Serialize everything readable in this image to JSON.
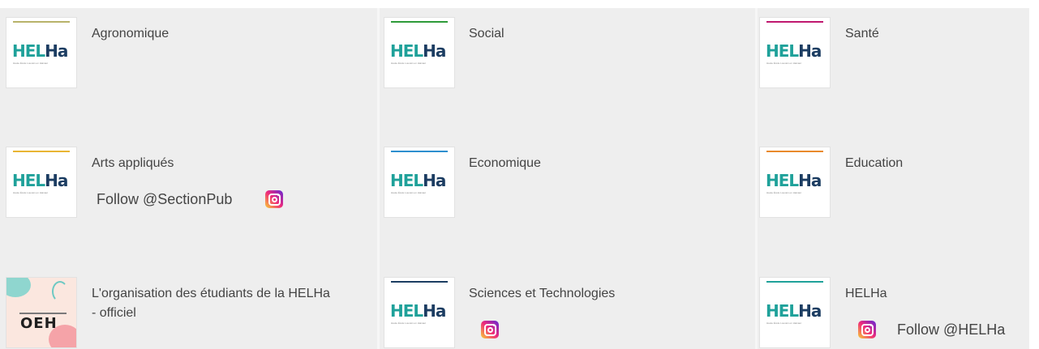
{
  "logo": {
    "helha_part1": "HEL",
    "helha_part2": "Ha",
    "helha_tagline": "Haute École Louvain en Hainaut",
    "oeh_text": "OEH"
  },
  "cards": [
    {
      "title": "Agronomique",
      "accent": "#b8b36a"
    },
    {
      "title": "Social",
      "accent": "#2e9b3a"
    },
    {
      "title": "Santé",
      "accent": "#c0186f"
    },
    {
      "title": "Arts appliqués",
      "accent": "#e9b534",
      "follow_label": "Follow @SectionPub"
    },
    {
      "title": "Economique",
      "accent": "#2d8fcf"
    },
    {
      "title": "Education",
      "accent": "#e98a2c"
    },
    {
      "title": "L'organisation des étudiants de la HELHa",
      "title_line2": "- officiel"
    },
    {
      "title": "Sciences et Technologies",
      "accent": "#1c3d62"
    },
    {
      "title": "HELHa",
      "accent": "#1fa19a",
      "follow_label": "Follow @HELHa"
    }
  ],
  "icons": {
    "social": "instagram-icon"
  },
  "colors": {
    "background": "#eeeeee",
    "text": "#444444",
    "brand_teal": "#1fa19a",
    "brand_navy": "#1c3d62"
  }
}
